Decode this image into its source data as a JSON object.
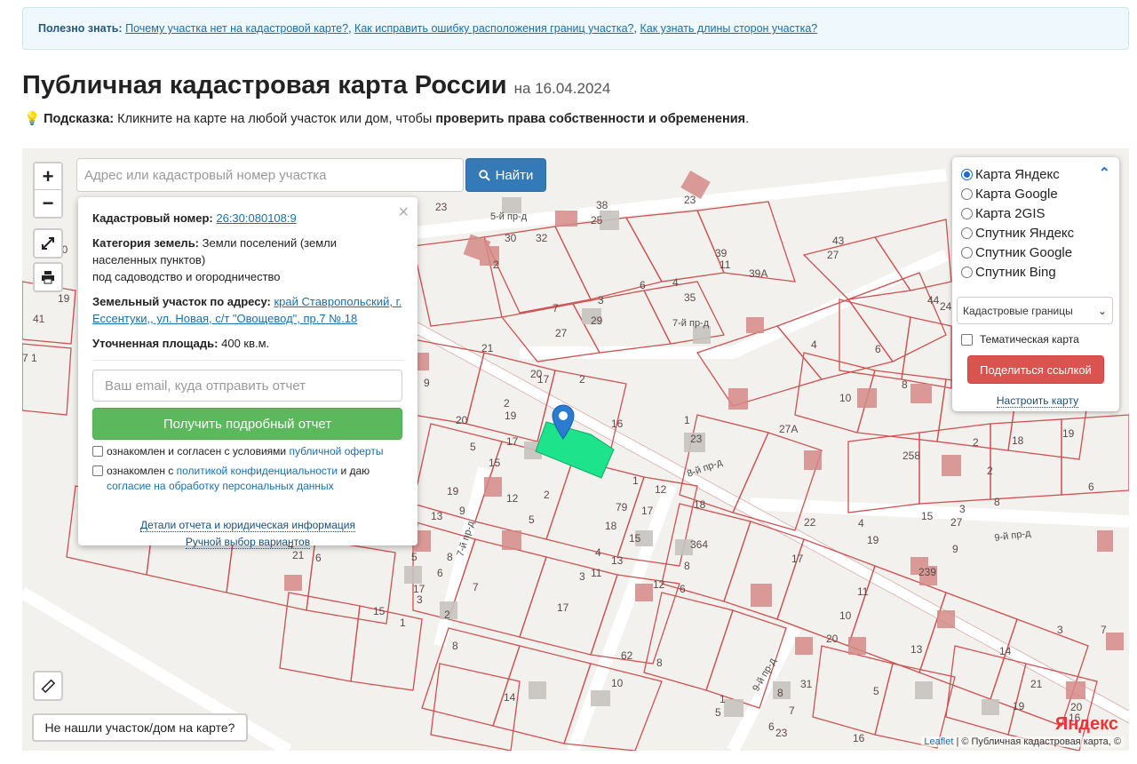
{
  "banner": {
    "label": "Полезно знать:",
    "links": [
      "Почему участка нет на кадастровой карте?",
      "Как исправить ошибку расположения границ участка?",
      "Как узнать длины сторон участка?"
    ]
  },
  "header": {
    "title": "Публичная кадастровая карта России",
    "date": "на 16.04.2024"
  },
  "hint": {
    "label": "Подсказка:",
    "text": "Кликните на карте на любой участок или дом, чтобы",
    "bold": "проверить права собственности и обременения",
    "end": "."
  },
  "map": {
    "zoom_in": "+",
    "zoom_out": "−",
    "search": {
      "placeholder": "Адрес или кадастровый номер участка",
      "button": "Найти"
    },
    "popup": {
      "cadnum_label": "Кадастровый номер:",
      "cadnum_value": "26:30:080108:9",
      "category_label": "Категория земель:",
      "category_value": "Земли поселений (земли населенных пунктов)",
      "usage": "под садоводство и огородничество",
      "address_label": "Земельный участок по адресу:",
      "address_value": "край Ставропольский, г. Ессентуки,, ул. Новая, с/т \"Овощевод\", пр.7 №.18",
      "area_label": "Уточненная площадь:",
      "area_value": "400 кв.м.",
      "email_placeholder": "Ваш email, куда отправить отчет",
      "report_button": "Получить подробный отчет",
      "agree1_text": "ознакомлен и согласен с условиями",
      "agree1_link": "публичной оферты",
      "agree2_text": "ознакомлен с",
      "agree2_link1": "политикой конфиденциальности",
      "agree2_mid": "и даю",
      "agree2_link2": "согласие на обработку персональных данных",
      "details_link": "Детали отчета и юридическая информация",
      "manual_link": "Ручной выбор вариантов"
    },
    "layers": {
      "base": [
        {
          "label": "Карта Яндекс",
          "selected": true
        },
        {
          "label": "Карта Google",
          "selected": false
        },
        {
          "label": "Карта 2GIS",
          "selected": false
        },
        {
          "label": "Спутник Яндекс",
          "selected": false
        },
        {
          "label": "Спутник Google",
          "selected": false
        },
        {
          "label": "Спутник Bing",
          "selected": false
        }
      ],
      "overlay_select": "Кадастровые границы",
      "thematic": "Тематическая карта",
      "share_button": "Поделиться ссылкой",
      "configure_link": "Настроить карту"
    },
    "not_found_button": "Не нашли участок/дом на карте?",
    "attribution_leaflet": "Leaflet",
    "attribution_rest": "| © Публичная кадастровая карта, ©",
    "yandex_logo": "Яндекс",
    "street_labels": [
      "5-й пр-д",
      "7-й пр-д",
      "8-й пр-д",
      "9-й пр-д",
      "7-й пр-д",
      "9-й пр-д"
    ],
    "plot_labels": [
      "23",
      "30",
      "32",
      "2",
      "38",
      "25",
      "22",
      "23",
      "29",
      "3",
      "7",
      "6",
      "4",
      "12",
      "35",
      "11",
      "39",
      "39А",
      "43",
      "27",
      "44",
      "24",
      "14",
      "13",
      "5",
      "21",
      "27",
      "20",
      "17",
      "2",
      "1",
      "4",
      "21",
      "6",
      "9",
      "19",
      "20",
      "5",
      "17",
      "15",
      "16",
      "23",
      "27А",
      "10",
      "43",
      "8",
      "42",
      "9",
      "1",
      "32",
      "12",
      "1",
      "18",
      "19",
      "258",
      "2",
      "18",
      "15",
      "22",
      "4",
      "23",
      "19",
      "27",
      "3",
      "5",
      "4",
      "6",
      "63",
      "12",
      "12",
      "8",
      "2",
      "5",
      "18",
      "364",
      "15",
      "17",
      "8",
      "11",
      "9",
      "13",
      "4",
      "13",
      "6",
      "12",
      "21",
      "12",
      "3",
      "11",
      "17",
      "6",
      "15",
      "10",
      "20",
      "13",
      "31",
      "8",
      "7",
      "14",
      "4",
      "10",
      "5",
      "6",
      "23",
      "8",
      "19",
      "19",
      "21",
      "20",
      "16",
      "14",
      "26",
      "1",
      "2",
      "21",
      "15"
    ]
  }
}
